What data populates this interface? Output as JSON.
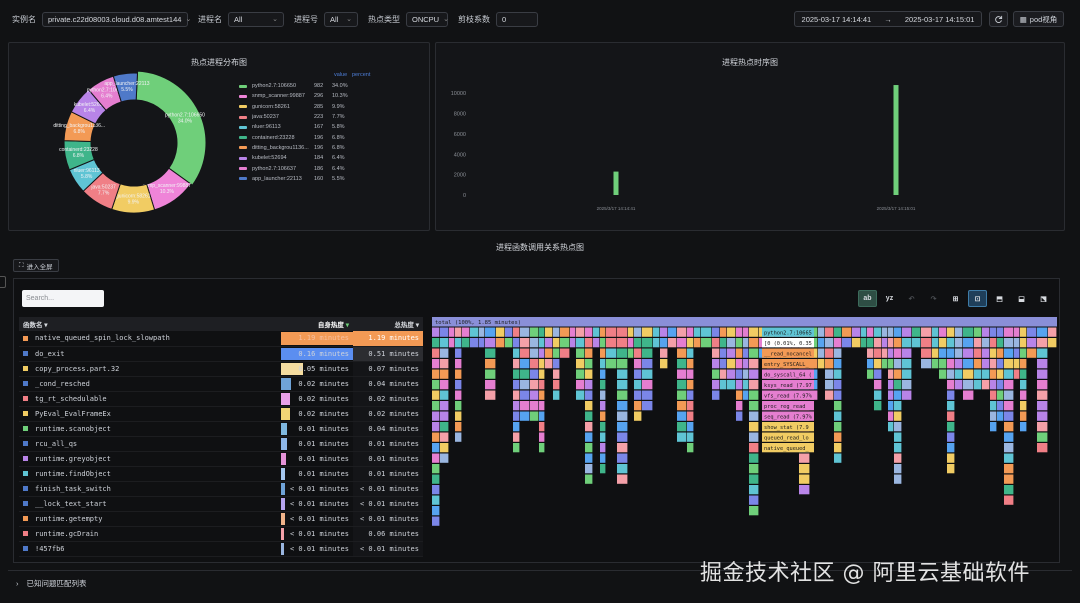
{
  "filters": {
    "instance_label": "实例名",
    "instance_value": "private.c22d08003.cloud.d08.amtest144",
    "process_label": "进程名",
    "process_value": "All",
    "pid_label": "进程号",
    "pid_value": "All",
    "hot_type_label": "热点类型",
    "hot_type_value": "ONCPU",
    "trim_label": "剪枝系数",
    "trim_value": "0",
    "date_start": "2025-03-17 14:14:41",
    "date_sep": "→",
    "date_end": "2025-03-17 14:15:01",
    "pod_view_label": "pod视角"
  },
  "pie_panel": {
    "title": "热点进程分布图",
    "legend_header_value": "value",
    "legend_header_percent": "percent",
    "items": [
      {
        "name": "python2.7:106650",
        "value": 982,
        "percent": "34.0%",
        "color": "#6fcf7a"
      },
      {
        "name": "snmp_scanner:99887",
        "value": 296,
        "percent": "10.3%",
        "color": "#ef84d8"
      },
      {
        "name": "gunicorn:58261",
        "value": 285,
        "percent": "9.9%",
        "color": "#f1cc63"
      },
      {
        "name": "java:50237",
        "value": 223,
        "percent": "7.7%",
        "color": "#f07f86"
      },
      {
        "name": "nluer:96113",
        "value": 167,
        "percent": "5.8%",
        "color": "#5fc4d4"
      },
      {
        "name": "containerd:23228",
        "value": 196,
        "percent": "6.8%",
        "color": "#3fb58a"
      },
      {
        "name": "ditting_backgrou1136...",
        "value": 196,
        "percent": "6.8%",
        "color": "#f39a55"
      },
      {
        "name": "kubelet:52694",
        "value": 184,
        "percent": "6.4%",
        "color": "#b884e8"
      },
      {
        "name": "python2.7:106637",
        "value": 186,
        "percent": "6.4%",
        "color": "#e57ed0"
      },
      {
        "name": "app_launcher:22113",
        "value": 160,
        "percent": "5.5%",
        "color": "#4f79c9"
      }
    ],
    "slice_labels": [
      {
        "text": "python2.7:106650",
        "pct": "34.0%"
      },
      {
        "text": "snmp_scanner:99887",
        "pct": "10.3%"
      },
      {
        "text": "gunicorn:58261",
        "pct": "9.9%"
      },
      {
        "text": "java:50237",
        "pct": "7.7%"
      },
      {
        "text": "nluer:96113",
        "pct": "5.8%"
      },
      {
        "text": "containerd:23228",
        "pct": "6.8%"
      },
      {
        "text": "ditting_backgrou1136...",
        "pct": "6.8%"
      },
      {
        "text": "kubelet:52694",
        "pct": "6.4%"
      },
      {
        "text": "python2.7:106637",
        "pct": "6.4%"
      },
      {
        "text": "app_launcher:22113",
        "pct": "5.5%"
      }
    ]
  },
  "chart_data": {
    "type": "bar",
    "title": "进程热点时序图",
    "categories": [
      "2025/3/17 14:14:41",
      "2025/3/17 14:15:01"
    ],
    "values": [
      2300,
      10800
    ],
    "yticks": [
      "0",
      "2000",
      "4000",
      "6000",
      "8000",
      "10000"
    ],
    "ylim": [
      0,
      11000
    ],
    "color": "#6fcf7a"
  },
  "flame_section": {
    "title": "进程函数调用关系热点图",
    "fullscreen_label": "进入全屏",
    "search_placeholder": "Search...",
    "tools": [
      "ab",
      "yz",
      "↶",
      "↷",
      "⊞",
      "⊡",
      "⬒",
      "⬓",
      "⬔"
    ],
    "columns": {
      "name": "函数名",
      "self": "自身热度",
      "total": "总热度"
    },
    "rows": [
      {
        "name": "native_queued_spin_lock_slowpath",
        "self": "1.19 minutes",
        "total": "1.19 minutes",
        "dot": "#f39a55",
        "bar": "#f39a55",
        "frac": 1.0
      },
      {
        "name": "do_exit",
        "self": "0.16 minutes",
        "total": "0.51 minutes",
        "dot": "#4f79c9",
        "bar": "#5b8ef0",
        "frac": 1.0
      },
      {
        "name": "copy_process.part.32",
        "self": "0.05 minutes",
        "total": "0.07 minutes",
        "dot": "#f1cc63",
        "bar": "#f4dca0",
        "frac": 0.3
      },
      {
        "name": "_cond_resched",
        "self": "0.02 minutes",
        "total": "0.04 minutes",
        "dot": "#4f79c9",
        "bar": "#6fa3d8",
        "frac": 0.14
      },
      {
        "name": "tg_rt_schedulable",
        "self": "0.02 minutes",
        "total": "0.02 minutes",
        "dot": "#f07f86",
        "bar": "#e9a0e8",
        "frac": 0.12
      },
      {
        "name": "PyEval_EvalFrameEx",
        "self": "0.02 minutes",
        "total": "0.02 minutes",
        "dot": "#f1cc63",
        "bar": "#f2d576",
        "frac": 0.12
      },
      {
        "name": "runtime.scanobject",
        "self": "0.01 minutes",
        "total": "0.04 minutes",
        "dot": "#6fcf7a",
        "bar": "#7fb8e0",
        "frac": 0.09
      },
      {
        "name": "rcu_all_qs",
        "self": "0.01 minutes",
        "total": "0.01 minutes",
        "dot": "#4f79c9",
        "bar": "#8db6e8",
        "frac": 0.08
      },
      {
        "name": "runtime.greyobject",
        "self": "0.01 minutes",
        "total": "0.01 minutes",
        "dot": "#b884e8",
        "bar": "#e593d8",
        "frac": 0.07
      },
      {
        "name": "runtime.findObject",
        "self": "0.01 minutes",
        "total": "0.01 minutes",
        "dot": "#5fc4d4",
        "bar": "#a6c8f0",
        "frac": 0.06
      },
      {
        "name": "finish_task_switch",
        "self": "< 0.01 minutes",
        "total": "< 0.01 minutes",
        "dot": "#4f79c9",
        "bar": "#6fa3d8",
        "frac": 0.05
      },
      {
        "name": "__lock_text_start",
        "self": "< 0.01 minutes",
        "total": "< 0.01 minutes",
        "dot": "#4f79c9",
        "bar": "#b6a4f0",
        "frac": 0.05
      },
      {
        "name": "runtime.getempty",
        "self": "< 0.01 minutes",
        "total": "< 0.01 minutes",
        "dot": "#f39a55",
        "bar": "#f0b38a",
        "frac": 0.05
      },
      {
        "name": "runtime.gcDrain",
        "self": "< 0.01 minutes",
        "total": "0.06 minutes",
        "dot": "#f07f86",
        "bar": "#f4a0a8",
        "frac": 0.04
      },
      {
        "name": "!457fb6",
        "self": "< 0.01 minutes",
        "total": "< 0.01 minutes",
        "dot": "#4f79c9",
        "bar": "#9ab6e0",
        "frac": 0.04
      }
    ],
    "flame_root_label": "total (100%, 1.85 minutes)",
    "flame_labels": [
      "python2.7:10665",
      "[0 (0.01%, 0.35",
      "__read_nocancel",
      "entry_SYSCALL_",
      "do_syscall_64 (",
      "ksys_read (7.97",
      "vfs_read (7.97%",
      "proc_reg_read",
      "seq_read (7.97%",
      "show_stat (7.9",
      "queued_read_lo",
      "native_queued_"
    ]
  },
  "bottom": {
    "label": "已知问题匹配列表"
  },
  "watermark": "掘金技术社区 @ 阿里云基础软件"
}
